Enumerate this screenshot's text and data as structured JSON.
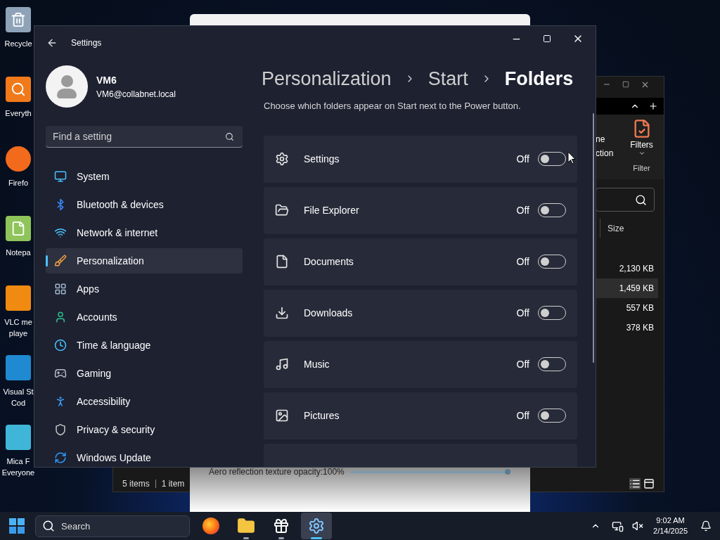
{
  "desktop_icons": [
    {
      "kind": "recycle",
      "lines": [
        "Recycle"
      ]
    },
    {
      "kind": "search",
      "lines": [
        "Everyth"
      ]
    },
    {
      "kind": "browser",
      "lines": [
        "Firefo"
      ]
    },
    {
      "kind": "notepad",
      "lines": [
        "Notepa"
      ]
    },
    {
      "kind": "cone",
      "lines": [
        "VLC me",
        "playe"
      ]
    },
    {
      "kind": "code",
      "lines": [
        "Visual St",
        "Cod"
      ]
    },
    {
      "kind": "app",
      "lines": [
        "Mica F",
        "Everyone"
      ]
    }
  ],
  "explorer": {
    "ribbon_texts": [
      "ne",
      "ction"
    ],
    "filters_label": "Filters",
    "group_label": "Filter",
    "column_header": "Size",
    "rows": [
      {
        "size": "2,130 KB",
        "selected": false
      },
      {
        "size": "1,459 KB",
        "selected": true
      },
      {
        "size": "557 KB",
        "selected": false
      },
      {
        "size": "378 KB",
        "selected": false
      }
    ],
    "status": [
      "5 items",
      "1 item"
    ]
  },
  "blur_window": {
    "slider_label": "Aero reflection texture opacity:100%",
    "level": 1.0
  },
  "settings": {
    "title": "Settings",
    "user": {
      "name": "VM6",
      "email": "VM6@collabnet.local"
    },
    "search": {
      "placeholder": "Find a setting"
    },
    "nav": [
      {
        "label": "System",
        "selected": false
      },
      {
        "label": "Bluetooth & devices",
        "selected": false
      },
      {
        "label": "Network & internet",
        "selected": false
      },
      {
        "label": "Personalization",
        "selected": true
      },
      {
        "label": "Apps",
        "selected": false
      },
      {
        "label": "Accounts",
        "selected": false
      },
      {
        "label": "Time & language",
        "selected": false
      },
      {
        "label": "Gaming",
        "selected": false
      },
      {
        "label": "Accessibility",
        "selected": false
      },
      {
        "label": "Privacy & security",
        "selected": false
      },
      {
        "label": "Windows Update",
        "selected": false
      }
    ],
    "breadcrumb": [
      "Personalization",
      "Start",
      "Folders"
    ],
    "description": "Choose which folders appear on Start next to the Power button.",
    "folders": [
      {
        "label": "Settings",
        "state": "Off",
        "on": false
      },
      {
        "label": "File Explorer",
        "state": "Off",
        "on": false
      },
      {
        "label": "Documents",
        "state": "Off",
        "on": false
      },
      {
        "label": "Downloads",
        "state": "Off",
        "on": false
      },
      {
        "label": "Music",
        "state": "Off",
        "on": false
      },
      {
        "label": "Pictures",
        "state": "Off",
        "on": false
      }
    ]
  },
  "taskbar": {
    "search": {
      "placeholder": "Search"
    },
    "apps": [
      {
        "kind": "browser",
        "running": false,
        "active": false
      },
      {
        "kind": "folder",
        "running": true,
        "active": false
      },
      {
        "kind": "gift",
        "running": true,
        "active": false
      },
      {
        "kind": "gear",
        "running": true,
        "active": true
      }
    ],
    "time": "9:02 AM",
    "date": "2/14/2025"
  }
}
